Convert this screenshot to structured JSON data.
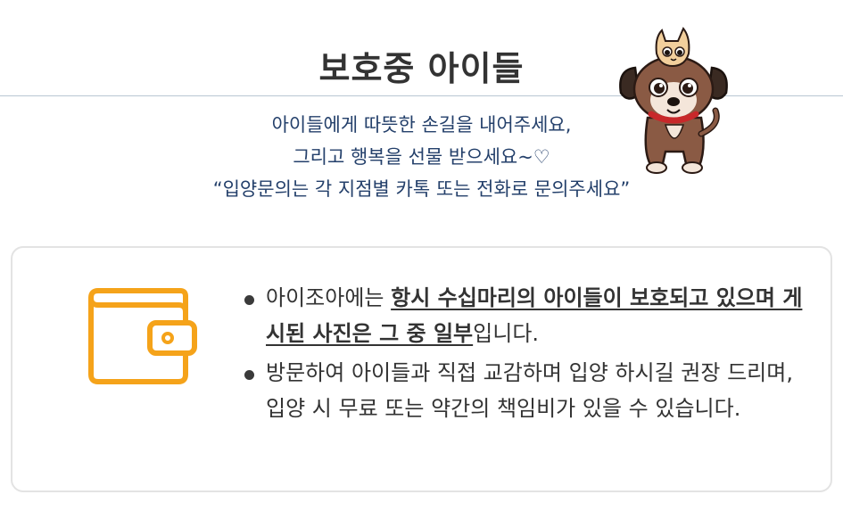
{
  "header": {
    "title": "보호중 아이들",
    "intro_lines": [
      "아이들에게 따뜻한 손길을 내어주세요,",
      "그리고 행복을 선물 받으세요~♡",
      "“입양문의는 각 지점별 카톡 또는 전화로 문의주세요”"
    ]
  },
  "info": {
    "icon": "wallet-icon",
    "notes": [
      {
        "prefix": "아이조아에는 ",
        "emphasis": "항시 수십마리의 아이들이 보호되고 있으며 게시된 사진은 그 중 일부",
        "suffix": "입니다."
      },
      {
        "text": "방문하여 아이들과 직접 교감하며 입양 하시길 권장 드리며, 입양 시 무료 또는 약간의 책임비가 있을 수 있습니다."
      }
    ]
  },
  "colors": {
    "title": "#333333",
    "intro_text": "#24406b",
    "rule": "#b9c6d3",
    "icon_accent": "#f5a31a",
    "card_border": "#e3e3e3"
  },
  "mascot_icon": "dog-and-cat-mascot-icon"
}
